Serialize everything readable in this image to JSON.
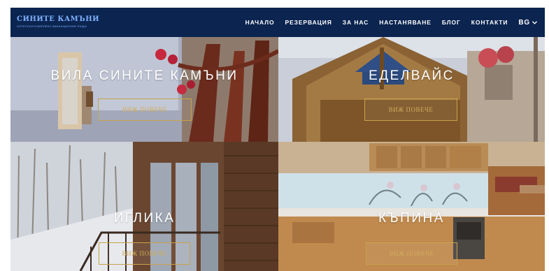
{
  "brand": {
    "name": "СИНИТЕ КАМЪНИ",
    "tagline": "ХОТЕЛСКИ КОМПЛЕКС ВАКАНЦИОННИ КЪЩИ"
  },
  "nav": {
    "items": [
      "НАЧАЛО",
      "РЕЗЕРВАЦИЯ",
      "ЗА НАС",
      "НАСТАНЯВАНЕ",
      "БЛОГ",
      "КОНТАКТИ"
    ],
    "language": "BG"
  },
  "properties": [
    {
      "name": "ВИЛА СИНИТЕ КАМЪНИ",
      "button_label": "ВИЖ ПОВЕЧЕ"
    },
    {
      "name": "ЕДЕЛВАЙС",
      "button_label": "ВИЖ ПОВЕЧЕ"
    },
    {
      "name": "ИГЛИКА",
      "button_label": "ВИЖ ПОВЕЧЕ"
    },
    {
      "name": "КЪПИНА",
      "button_label": "ВИЖ ПОВЕЧЕ"
    }
  ],
  "colors": {
    "navbar": "#0b2450",
    "logo": "#7fb2ff",
    "accent_gold": "#c9a24a"
  }
}
